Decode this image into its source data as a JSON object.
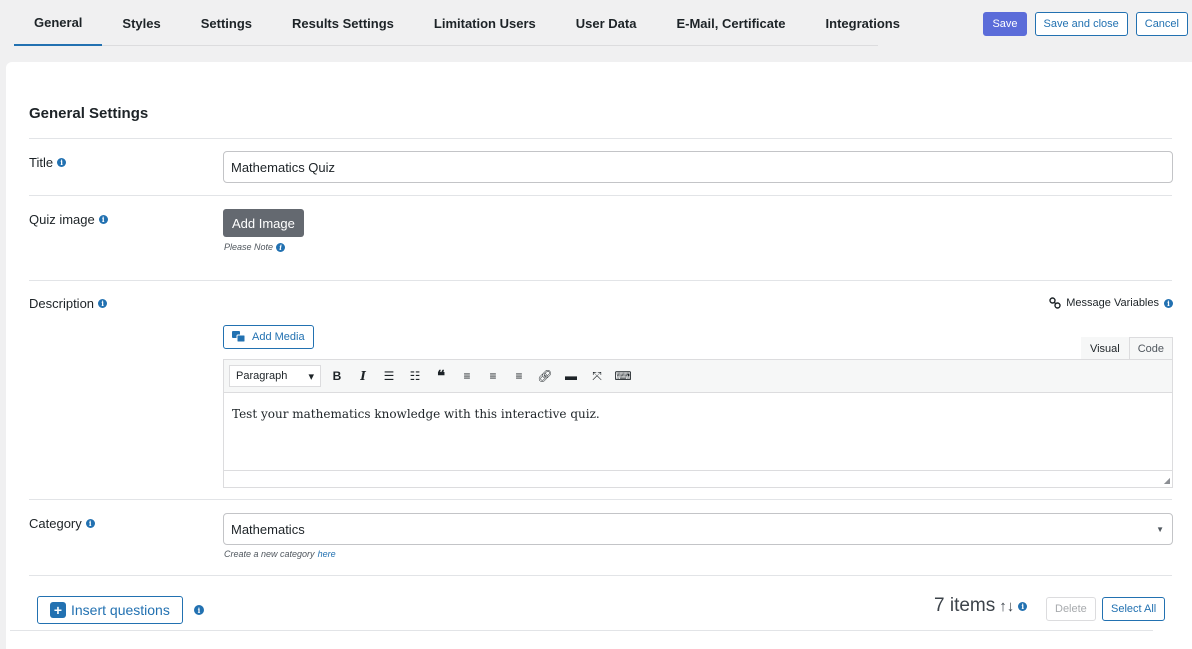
{
  "tabs": [
    "General",
    "Styles",
    "Settings",
    "Results Settings",
    "Limitation Users",
    "User Data",
    "E-Mail, Certificate",
    "Integrations"
  ],
  "active_tab": "General",
  "actions": {
    "save": "Save",
    "save_close": "Save and close",
    "cancel": "Cancel"
  },
  "section_title": "General Settings",
  "fields": {
    "title_label": "Title",
    "title_value": "Mathematics Quiz",
    "quiz_image_label": "Quiz image",
    "add_image": "Add Image",
    "please_note": "Please Note",
    "description_label": "Description",
    "message_variables": "Message Variables",
    "add_media": "Add Media",
    "editor_tab_visual": "Visual",
    "editor_tab_code": "Code",
    "paragraph_select": "Paragraph",
    "description_text": "Test your mathematics knowledge with this interactive quiz.",
    "category_label": "Category",
    "category_value": "Mathematics",
    "create_category": "Create a new category",
    "create_category_link": "here"
  },
  "questions": {
    "insert": "Insert questions",
    "count": "7 items",
    "delete": "Delete",
    "select_all": "Select All"
  },
  "colors": {
    "accent": "#2271b1",
    "primary_button": "#5b6cd9",
    "dark_button": "#646970"
  }
}
